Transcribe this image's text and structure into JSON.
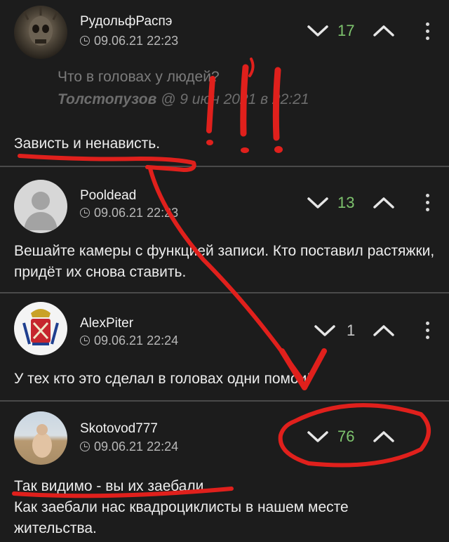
{
  "comments": [
    {
      "author": "РудольфРаспэ",
      "date": "09.06.21 22:23",
      "votes": "17",
      "quote_text": "Что в головах у людей?",
      "quote_author": "Толстопузов",
      "quote_meta_rest": " @ 9 июн 2021 в 22:21",
      "text": "Зависть и ненависть."
    },
    {
      "author": "Pooldead",
      "date": "09.06.21 22:23",
      "votes": "13",
      "text": "Вешайте камеры с функцией записи. Кто поставил растяжки, придёт их снова ставить."
    },
    {
      "author": "AlexPiter",
      "date": "09.06.21 22:24",
      "votes": "1",
      "text": "У тех кто это сделал в головах одни помои!"
    },
    {
      "author": "Skotovod777",
      "date": "09.06.21 22:24",
      "votes": "76",
      "text_line1": "Так видимо - вы их заебали.",
      "text_line2": "Как заебали нас квадроциклисты в нашем месте жительства."
    }
  ],
  "colors": {
    "background": "#1c1c1c",
    "vote_positive": "#7ec46e",
    "annotation": "#e0201c"
  }
}
